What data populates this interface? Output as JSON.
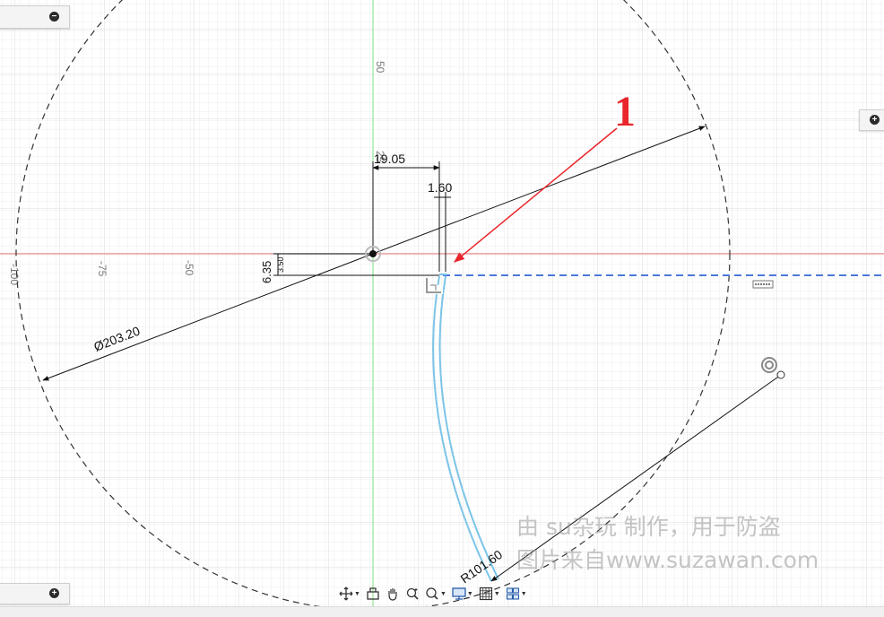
{
  "axis_labels": {
    "y_50": "50",
    "y_25": "25",
    "x_neg100": "-100",
    "x_neg75": "-75",
    "x_neg50": "-50"
  },
  "dimensions": {
    "diameter": "Ø203.20",
    "width_19": "19.05",
    "thickness": "1.60",
    "offset": "6.35",
    "small_gap": "3.50",
    "radius": "R101.60"
  },
  "callout": {
    "label": "1",
    "color": "#e8262b"
  },
  "watermark": {
    "line1": "由 su杂玩 制作，用于防盗",
    "line2": "图片来自www.suzawan.com"
  },
  "colors": {
    "grid_minor": "#eeeeee",
    "grid_major": "#dddddd",
    "x_axis": "#f08080",
    "y_axis": "#7ee07e",
    "profile": "#7cc4e8",
    "construction_blue": "#4d78d9",
    "dimension_line": "#111111"
  },
  "icons": {
    "orbit": "orbit-icon",
    "look_at": "look-at-icon",
    "pan": "pan-icon",
    "zoom": "zoom-icon",
    "fit": "fit-icon",
    "display": "display-settings-icon",
    "grid": "grid-settings-icon",
    "viewports": "viewports-icon"
  }
}
